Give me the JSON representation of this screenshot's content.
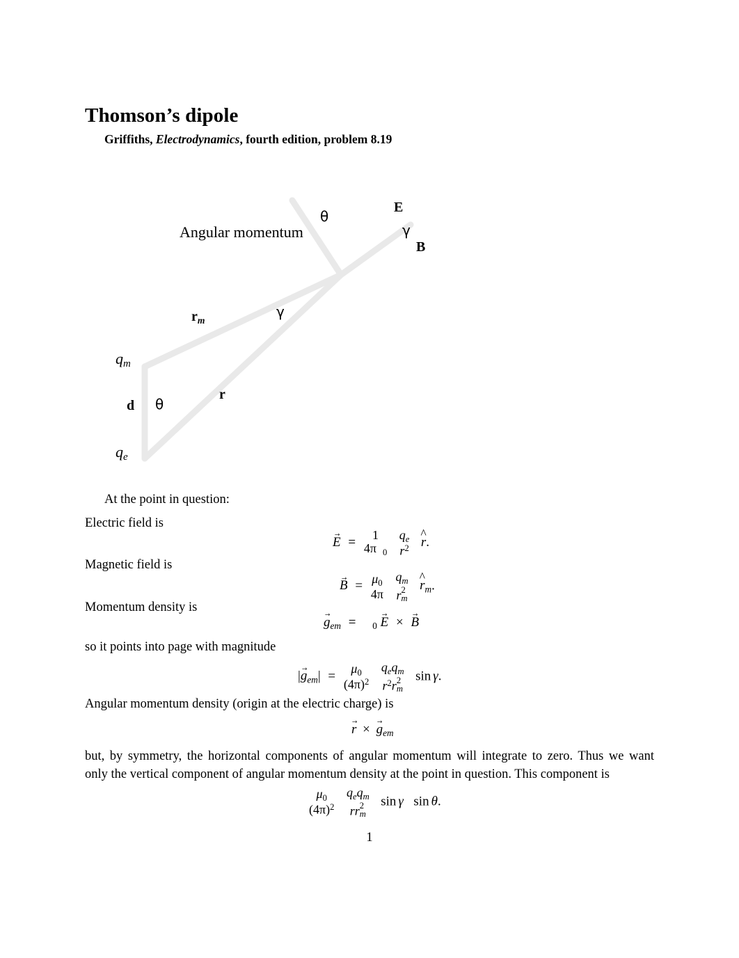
{
  "document": {
    "title": "Thomson’s dipole",
    "subtitle_pre": "Griffiths, ",
    "subtitle_italic": "Electrodynamics",
    "subtitle_post": ", fourth edition, problem 8.19",
    "page_number": "1"
  },
  "figure": {
    "labels": {
      "angular_momentum": "Angular momentum",
      "theta_top": "θ",
      "E": "E",
      "gamma_top": "γ",
      "B": "B",
      "r_m": "r",
      "r_m_sub": "m",
      "gamma_mid": "γ",
      "q_m": "q",
      "q_m_sub": "m",
      "d": "d",
      "theta_bottom": "θ",
      "r": "r",
      "q_e": "q",
      "q_e_sub": "e"
    },
    "line_color": "#e9e9e9"
  },
  "body": {
    "intro": "At the point in question:",
    "electric_field_lead": "Electric field is",
    "magnetic_field_lead": "Magnetic field is",
    "momentum_density_lead": "Momentum density is",
    "points_into_page_lead": "so it points into page with magnitude",
    "angular_momentum_lead": "Angular momentum density (origin at the electric charge) is",
    "closing_line_1": "but, by symmetry, the horizontal components of angular momentum will integrate to zero. Thus we want",
    "closing_line_2": "only the vertical component of angular momentum density at the point in question. This component is"
  },
  "equations": {
    "electric_field": {
      "lhs": "E",
      "eq": "=",
      "num_left": "1",
      "den_left_pre": "4π",
      "den_left_eps": "",
      "den_left_sub": "0",
      "num_right": "q",
      "num_right_sub": "e",
      "den_right": "r",
      "den_right_sup": "2",
      "unit": "r",
      "period": "."
    },
    "magnetic_field": {
      "lhs": "B",
      "eq": "=",
      "num_left": "μ",
      "num_left_sub": "0",
      "den_left": "4π",
      "num_right": "q",
      "num_right_sub": "m",
      "den_right": "r",
      "den_right_sub": "m",
      "den_right_sup": "2",
      "unit": "r",
      "unit_sub": "m",
      "period": "."
    },
    "momentum_density": {
      "lhs": "g",
      "lhs_sub": "em",
      "eq": "=",
      "eps": "",
      "eps_sub": "0",
      "E": "E",
      "times": "×",
      "B": "B"
    },
    "momentum_magnitude": {
      "lhs_bar_open": "|",
      "lhs": "g",
      "lhs_sub": "em",
      "lhs_bar_close": "|",
      "eq": "=",
      "num_left": "μ",
      "num_left_sub": "0",
      "den_left": "(4π)",
      "den_left_sup": "2",
      "num_right_1": "q",
      "num_right_1_sub": "e",
      "num_right_2": "q",
      "num_right_2_sub": "m",
      "den_right_1": "r",
      "den_right_1_sup": "2",
      "den_right_2": "r",
      "den_right_2_sub": "m",
      "den_right_2_sup": "2",
      "trig": "sin",
      "trig_arg": "γ",
      "period": "."
    },
    "angular_momentum_density": {
      "r": "r",
      "times": "×",
      "g": "g",
      "g_sub": "em"
    },
    "vertical_component": {
      "num_left": "μ",
      "num_left_sub": "0",
      "den_left": "(4π)",
      "den_left_sup": "2",
      "num_right_1": "q",
      "num_right_1_sub": "e",
      "num_right_2": "q",
      "num_right_2_sub": "m",
      "den_right_1": "r",
      "den_right_2": "r",
      "den_right_2_sub": "m",
      "den_right_2_sup": "2",
      "trig_1": "sin",
      "trig_1_arg": "γ",
      "trig_2": "sin",
      "trig_2_arg": "θ",
      "period": "."
    }
  }
}
